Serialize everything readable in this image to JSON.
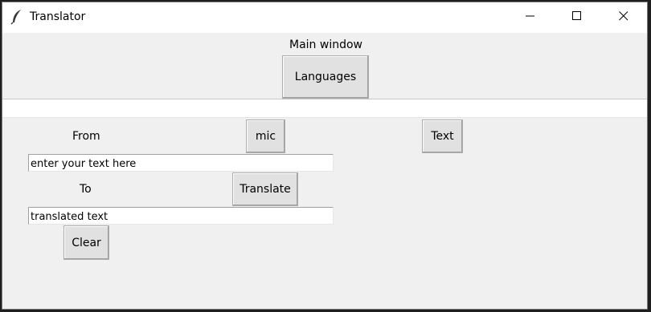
{
  "window": {
    "title": "Translator",
    "controls": [
      "minimize",
      "maximize",
      "close"
    ]
  },
  "main": {
    "heading": "Main window",
    "languages_button": "Languages",
    "from_label": "From",
    "mic_button": "mic",
    "text_button": "Text",
    "input_value": "enter your text here",
    "to_label": "To",
    "translate_button": "Translate",
    "output_value": "translated text",
    "clear_button": "Clear"
  },
  "colors": {
    "window_bg": "#f0f0f0",
    "titlebar_bg": "#ffffff",
    "button_bg": "#e1e1e1"
  },
  "icons": {
    "app": "feather-icon",
    "minimize": "minimize-icon",
    "maximize": "maximize-icon",
    "close": "close-icon"
  }
}
